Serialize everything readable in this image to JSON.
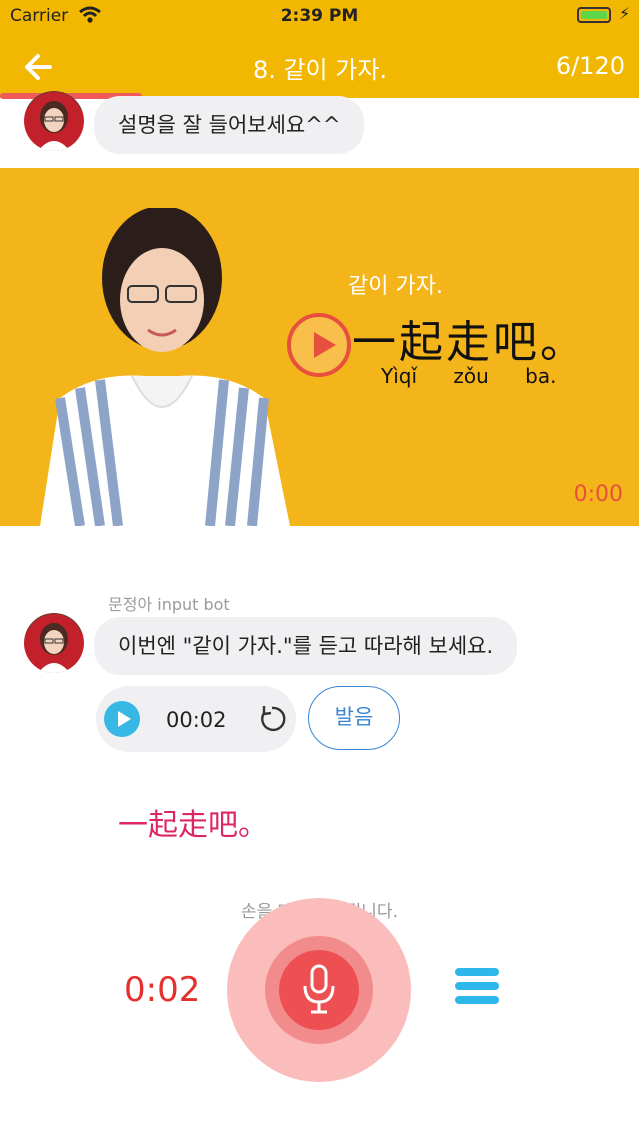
{
  "status_bar": {
    "carrier": "Carrier",
    "time": "2:39 PM"
  },
  "header": {
    "title": "8. 같이 가자.",
    "counter": "6/120"
  },
  "chat": {
    "first_message": "설명을 잘 들어보세요^^",
    "bot_name": "문정아 input bot",
    "second_message": "이번엔 \"같이 가자.\"를 듣고 따라해 보세요."
  },
  "video": {
    "subtitle": "같이 가자.",
    "hanzi": "一起走吧。",
    "pinyin": "Yìqǐ zǒu ba.",
    "time": "0:00"
  },
  "audio": {
    "time": "00:02",
    "pronunciation_label": "발음"
  },
  "answer": {
    "hanzi": "一起走吧。"
  },
  "recorder": {
    "hint": "손을 떼면 전송됩니다.",
    "elapsed": "0:02"
  },
  "colors": {
    "header": "#f2b700",
    "accent_red": "#e3322e",
    "accent_blue": "#37b8e4",
    "hanzi_pink": "#dc2764"
  }
}
